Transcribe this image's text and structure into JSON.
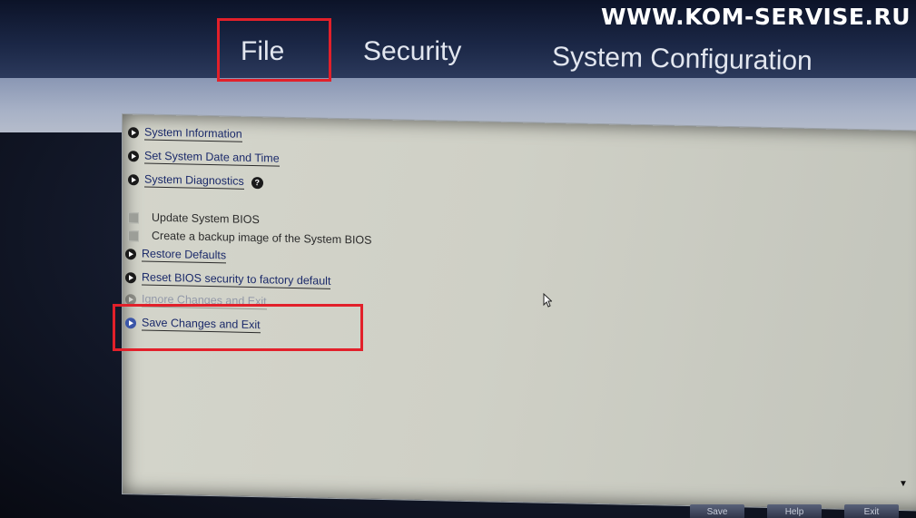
{
  "watermark": "WWW.KOM-SERVISE.RU",
  "tabs": [
    {
      "label": "File"
    },
    {
      "label": "Security"
    },
    {
      "label": "System Configuration"
    }
  ],
  "menu": {
    "system_information": "System Information",
    "set_date_time": "Set System Date and Time",
    "system_diagnostics": "System Diagnostics",
    "update_bios": "Update System BIOS",
    "backup_bios": "Create a backup image of the System BIOS",
    "restore_defaults": "Restore Defaults",
    "reset_security": "Reset BIOS security to factory default",
    "ignore_changes": "Ignore Changes and Exit",
    "save_changes": "Save Changes and Exit"
  },
  "footer": {
    "save": "Save",
    "help": "Help",
    "exit": "Exit"
  },
  "icons": [
    "help-icon",
    "cursor-icon",
    "scroll-down-icon"
  ],
  "colors": {
    "highlight": "#e2202a",
    "link": "#1b2a6a",
    "panel": "#d0d1c7"
  }
}
